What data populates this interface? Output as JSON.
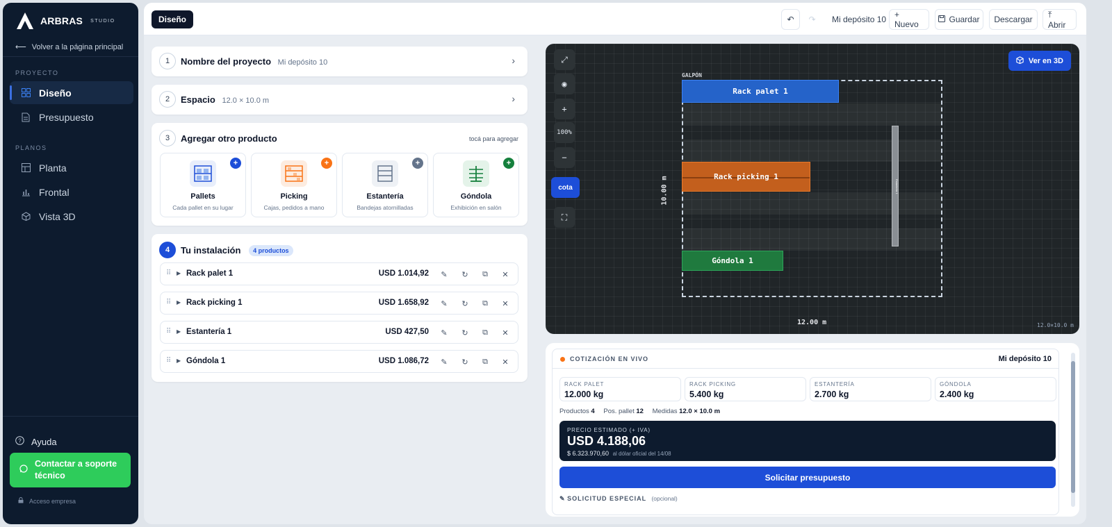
{
  "brand": {
    "name": "ARBRAS",
    "sub": "STUDIO"
  },
  "sidebar": {
    "back_label": "Volver a la página principal",
    "section_proyecto": "PROYECTO",
    "section_planos": "PLANOS",
    "items": [
      {
        "label": "Diseño",
        "icon": "grid-icon"
      },
      {
        "label": "Presupuesto",
        "icon": "document-icon"
      },
      {
        "label": "Planta",
        "icon": "floorplan-icon"
      },
      {
        "label": "Frontal",
        "icon": "bar-chart-icon"
      },
      {
        "label": "Vista 3D",
        "icon": "cube-icon"
      }
    ],
    "help_label": "Ayuda",
    "support_label": "Contactar a soporte técnico",
    "company_label": "Acceso empresa"
  },
  "topbar": {
    "tab": "Diseño",
    "project_name": "Mi depósito 10",
    "new_label": "+ Nuevo",
    "save_label": "Guardar",
    "download_label": "Descargar",
    "open_label": "⤒ Abrir"
  },
  "steps": {
    "s1": {
      "num": "1",
      "title": "Nombre del proyecto",
      "value": "Mi depósito 10"
    },
    "s2": {
      "num": "2",
      "title": "Espacio",
      "value": "12.0 × 10.0 m"
    },
    "s3": {
      "num": "3",
      "title": "Agregar otro producto",
      "hint": "tocá para agregar"
    },
    "s4": {
      "num": "4",
      "title": "Tu instalación",
      "badge": "4 productos"
    }
  },
  "products": [
    {
      "name": "Pallets",
      "desc": "Cada pallet en su lugar",
      "color": "#1d4ed8"
    },
    {
      "name": "Picking",
      "desc": "Cajas, pedidos a mano",
      "color": "#f97316"
    },
    {
      "name": "Estantería",
      "desc": "Bandejas atornilladas",
      "color": "#64748b"
    },
    {
      "name": "Góndola",
      "desc": "Exhibición en salón",
      "color": "#15803d"
    }
  ],
  "installation": [
    {
      "name": "Rack palet 1",
      "price": "USD 1.014,92"
    },
    {
      "name": "Rack picking 1",
      "price": "USD 1.658,92"
    },
    {
      "name": "Estantería 1",
      "price": "USD 427,50"
    },
    {
      "name": "Góndola 1",
      "price": "USD 1.086,72"
    }
  ],
  "canvas": {
    "zoom": "100%",
    "cota_label": "cota",
    "ver3d_label": "Ver en 3D",
    "galpon_label": "GALPÓN",
    "rack_pallet": "Rack palet 1",
    "rack_picking": "Rack picking 1",
    "gondola": "Góndola 1",
    "estanteria": "Estantería 1",
    "width_label": "12.00 m",
    "height_label": "10.00 m",
    "scale_label": "12.0×10.0 m"
  },
  "quote": {
    "live_label": "COTIZACIÓN EN VIVO",
    "project": "Mi depósito 10",
    "weights": [
      {
        "label": "RACK PALET",
        "value": "12.000 kg"
      },
      {
        "label": "RACK PICKING",
        "value": "5.400 kg"
      },
      {
        "label": "ESTANTERÍA",
        "value": "2.700 kg"
      },
      {
        "label": "GÓNDOLA",
        "value": "2.400 kg"
      }
    ],
    "productos_label": "Productos",
    "productos_value": "4",
    "pos_label": "Pos. pallet",
    "pos_value": "12",
    "medidas_label": "Medidas",
    "medidas_value": "12.0 × 10.0 m",
    "price_label": "PRECIO ESTIMADO (+ IVA)",
    "price_value": "USD 4.188,06",
    "ars_value": "$ 6.323.970,60",
    "ars_note": "al dólar oficial del 14/08",
    "request_label": "Solicitar presupuesto",
    "special_label": "SOLICITUD ESPECIAL",
    "special_optional": "(opcional)"
  }
}
